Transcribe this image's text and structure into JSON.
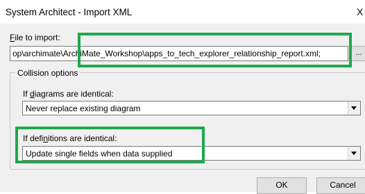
{
  "window": {
    "title": "System Architect - Import XML",
    "close_glyph": "X"
  },
  "file_import": {
    "label_key": "F",
    "label_rest": "ile to import:",
    "value": "op\\archimate\\ArchiMate_Workshop\\apps_to_tech_explorer_relationship_report.xml;",
    "browse_label": "..."
  },
  "collision": {
    "group_title": "Collision options",
    "diagrams": {
      "label_pre": "If ",
      "label_key": "d",
      "label_post": "iagrams are identical:",
      "selected": "Never replace existing diagram"
    },
    "definitions": {
      "label_pre": "If defi",
      "label_key": "n",
      "label_post": "itions are identical:",
      "selected": "Update single fields when data supplied"
    }
  },
  "buttons": {
    "ok": "OK",
    "cancel": "Cancel"
  },
  "colors": {
    "highlight": "#1fa84d",
    "dialog_bg": "#f0f0f0"
  }
}
